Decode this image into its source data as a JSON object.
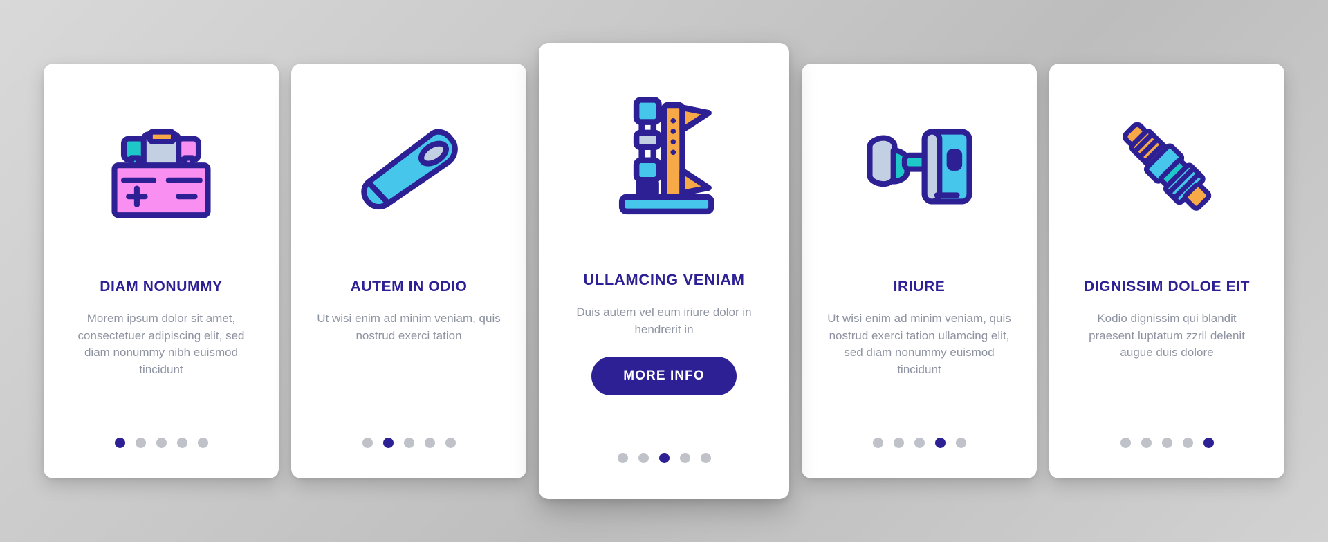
{
  "meta": {
    "screen_kind": "onboarding-carousel-mockup",
    "background_color": "#cfcfcf",
    "accent_color": "#2d2095",
    "title_color": "#2d2095",
    "body_color": "#8d93a1",
    "dot_active_color": "#2d2095",
    "dot_inactive_color": "#bfc3c9",
    "card_background": "#ffffff"
  },
  "cards": [
    {
      "id": "card-1",
      "icon_name": "car-battery-icon",
      "title": "DIAM NONUMMY",
      "description": "Morem ipsum dolor sit amet, consectetuer adipiscing elit, sed diam nonummy nibh euismod tincidunt",
      "dots": {
        "count": 5,
        "active_index": 0
      },
      "has_button": false,
      "featured": false
    },
    {
      "id": "card-2",
      "icon_name": "air-blow-gun-icon",
      "title": "AUTEM IN ODIO",
      "description": "Ut wisi enim ad minim veniam, quis nostrud exerci tation",
      "dots": {
        "count": 5,
        "active_index": 1
      },
      "has_button": false,
      "featured": false
    },
    {
      "id": "card-3",
      "icon_name": "micrometer-caliper-icon",
      "title": "ULLAMCING VENIAM",
      "description": "Duis autem vel eum iriure dolor in hendrerit in",
      "dots": {
        "count": 5,
        "active_index": 2
      },
      "has_button": true,
      "button_label": "MORE INFO",
      "featured": true
    },
    {
      "id": "card-4",
      "icon_name": "phone-suction-holder-icon",
      "title": "IRIURE",
      "description": "Ut wisi enim ad minim veniam, quis nostrud exerci tation ullamcing elit, sed diam nonummy euismod tincidunt",
      "dots": {
        "count": 5,
        "active_index": 3
      },
      "has_button": false,
      "featured": false
    },
    {
      "id": "card-5",
      "icon_name": "spark-plug-icon",
      "title": "DIGNISSIM DOLOE EIT",
      "description": "Kodio dignissim qui blandit praesent luptatum zzril delenit augue duis dolore",
      "dots": {
        "count": 5,
        "active_index": 4
      },
      "has_button": false,
      "featured": false
    }
  ],
  "palette": {
    "outline": "#2d2095",
    "pink": "#f98ff0",
    "cyan": "#2fc6d8",
    "teal": "#1fc8c8",
    "orange": "#f5a councils",
    "orange_real": "#f7a947",
    "light_blue": "#c3cfe2",
    "sky": "#45c6ea",
    "grey": "#d7dce6"
  }
}
